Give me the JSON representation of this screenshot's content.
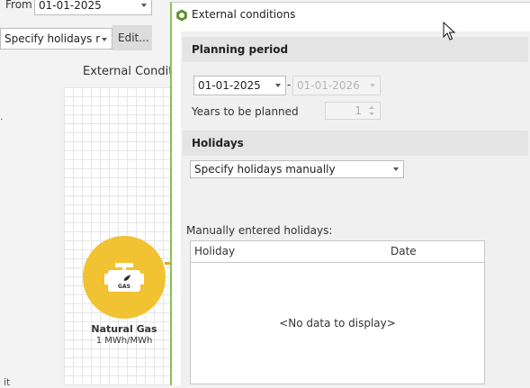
{
  "background": {
    "from_label": "From",
    "from_date": "01-01-2025",
    "holidays_combo": "Specify holidays r",
    "edit_button": "Edit...",
    "canvas_title": "External Conditi",
    "gas_node": {
      "icon_text": "GAS",
      "label": "Natural Gas",
      "sublabel": "1 MWh/MWh"
    },
    "left_cut_text": "it"
  },
  "dialog": {
    "title": "External conditions",
    "accent_color": "#8bc34a",
    "planning_period": {
      "header": "Planning period",
      "start_date": "01-01-2025",
      "separator": "-",
      "end_date": "01-01-2026",
      "years_label": "Years to be planned",
      "years_value": "1"
    },
    "holidays": {
      "header": "Holidays",
      "mode": "Specify holidays manually",
      "manual_label": "Manually entered holidays:",
      "columns": [
        "Holiday",
        "Date"
      ],
      "empty_text": "<No data to display>"
    }
  },
  "colors": {
    "gas_node": "#f1c232",
    "section_header": "#e4e4e4"
  }
}
